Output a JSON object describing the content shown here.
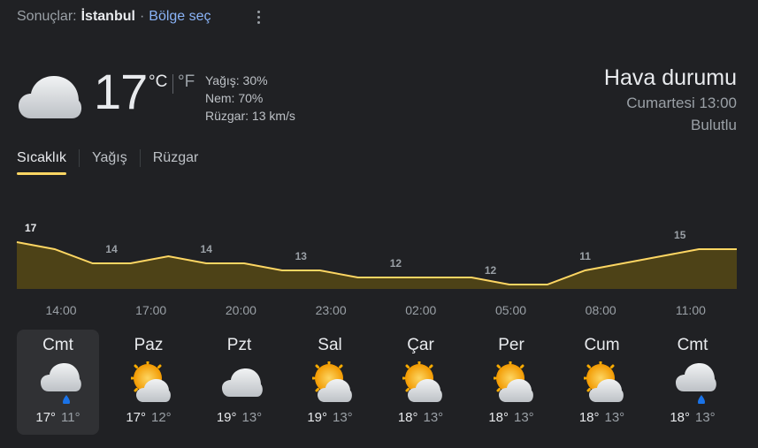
{
  "header": {
    "prefix": "Sonuçlar:",
    "city": "İstanbul",
    "separator": "·",
    "region_link": "Bölge seç"
  },
  "current": {
    "icon": "cloud-icon",
    "temperature": "17",
    "unit_c": "°C",
    "unit_f": "°F",
    "precip": "Yağış: 30%",
    "humidity": "Nem: 70%",
    "wind": "Rüzgar: 13 km/s"
  },
  "summary": {
    "title": "Hava durumu",
    "datetime": "Cumartesi 13:00",
    "condition": "Bulutlu"
  },
  "tabs": [
    {
      "label": "Sıcaklık",
      "active": true
    },
    {
      "label": "Yağış",
      "active": false
    },
    {
      "label": "Rüzgar",
      "active": false
    }
  ],
  "chart_data": {
    "type": "area",
    "temps": [
      17,
      16,
      14,
      14,
      15,
      14,
      14,
      13,
      13,
      12,
      12,
      12,
      12,
      11,
      11,
      13,
      14,
      15,
      16,
      16
    ],
    "point_labels": [
      "17",
      "14",
      "14",
      "13",
      "12",
      "12",
      "11",
      "15"
    ],
    "time_labels": [
      "14:00",
      "17:00",
      "20:00",
      "23:00",
      "02:00",
      "05:00",
      "08:00",
      "11:00"
    ],
    "line_color": "#fdd663",
    "fill_color": "#4d4217"
  },
  "forecast": [
    {
      "day": "Cmt",
      "icon": "rain-cloud-icon",
      "hi": "17°",
      "lo": "11°",
      "selected": true
    },
    {
      "day": "Paz",
      "icon": "partly-sunny-icon",
      "hi": "17°",
      "lo": "12°"
    },
    {
      "day": "Pzt",
      "icon": "cloud-icon",
      "hi": "19°",
      "lo": "13°"
    },
    {
      "day": "Sal",
      "icon": "partly-sunny-icon",
      "hi": "19°",
      "lo": "13°"
    },
    {
      "day": "Çar",
      "icon": "partly-sunny-icon",
      "hi": "18°",
      "lo": "13°"
    },
    {
      "day": "Per",
      "icon": "partly-sunny-icon",
      "hi": "18°",
      "lo": "13°"
    },
    {
      "day": "Cum",
      "icon": "partly-sunny-icon",
      "hi": "18°",
      "lo": "13°"
    },
    {
      "day": "Cmt",
      "icon": "rain-cloud-icon",
      "hi": "18°",
      "lo": "13°"
    }
  ]
}
